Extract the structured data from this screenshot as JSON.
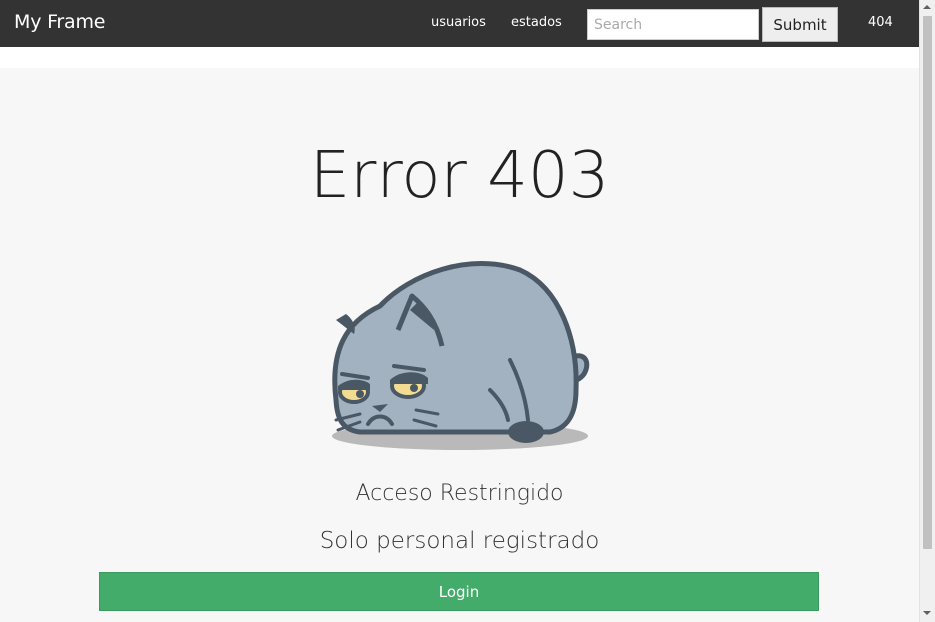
{
  "navbar": {
    "brand": "My Frame",
    "links": [
      {
        "label": "usuarios"
      },
      {
        "label": "estados"
      }
    ],
    "search": {
      "placeholder": "Search",
      "value": ""
    },
    "submit_label": "Submit",
    "extra_link": "404"
  },
  "main": {
    "title": "Error 403",
    "illustration": "grumpy-cat-illustration",
    "message_1": "Acceso Restringido",
    "message_2": "Solo personal registrado",
    "login_label": "Login"
  },
  "colors": {
    "navbar_bg": "#333333",
    "panel_bg": "#f7f7f7",
    "login_button": "#43ac6a"
  }
}
